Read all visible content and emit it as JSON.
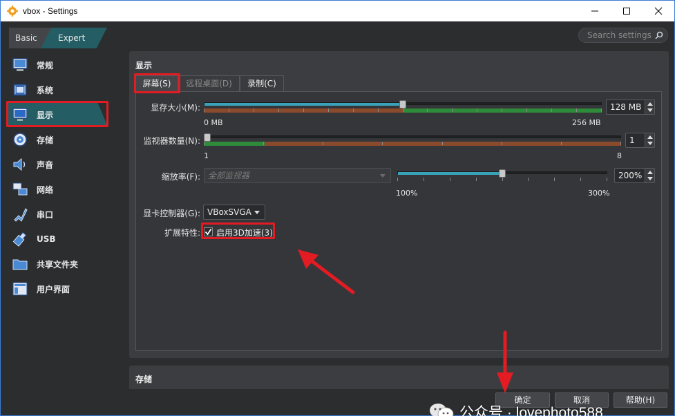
{
  "window": {
    "title": "vbox - Settings",
    "controls": [
      "minimize-icon",
      "maximize-icon",
      "close-icon"
    ]
  },
  "mode": {
    "basic_label": "Basic",
    "expert_label": "Expert",
    "active": "Expert"
  },
  "search": {
    "placeholder": "Search settings"
  },
  "sidebar": {
    "items": [
      {
        "label": "常规",
        "icon": "general-icon"
      },
      {
        "label": "系统",
        "icon": "system-chip-icon"
      },
      {
        "label": "显示",
        "icon": "display-monitor-icon",
        "active": true
      },
      {
        "label": "存储",
        "icon": "storage-disk-icon"
      },
      {
        "label": "声音",
        "icon": "audio-speaker-icon"
      },
      {
        "label": "网络",
        "icon": "network-icon"
      },
      {
        "label": "串口",
        "icon": "serial-port-icon"
      },
      {
        "label": "USB",
        "icon": "usb-icon"
      },
      {
        "label": "共享文件夹",
        "icon": "shared-folder-icon"
      },
      {
        "label": "用户界面",
        "icon": "user-interface-icon"
      }
    ]
  },
  "display": {
    "section_title": "显示",
    "tabs": [
      {
        "label": "屏幕(S)",
        "active": true,
        "enabled": true
      },
      {
        "label": "远程桌面(D)",
        "active": false,
        "enabled": false
      },
      {
        "label": "录制(C)",
        "active": false,
        "enabled": true
      }
    ],
    "video_memory": {
      "label": "显存大小(M):",
      "value": "128 MB",
      "min_label": "0 MB",
      "max_label": "256 MB",
      "fraction": 0.5
    },
    "monitor_count": {
      "label": "监视器数量(N):",
      "value": "1",
      "min_label": "1",
      "max_label": "8",
      "fraction": 0.0
    },
    "scale_factor": {
      "label": "缩放率(F):",
      "combo_placeholder": "全部监视器",
      "value": "200%",
      "min_label": "100%",
      "max_label": "300%",
      "fraction": 0.5
    },
    "graphics_controller": {
      "label": "显卡控制器(G):",
      "value": "VBoxSVGA"
    },
    "extended_features": {
      "label": "扩展特性:",
      "checkbox_label": "启用3D加速(3)",
      "checked": true
    }
  },
  "storage": {
    "section_title": "存储"
  },
  "buttons": {
    "ok": "确定",
    "cancel": "取消",
    "help": "帮助(H)"
  },
  "watermark": {
    "text": "公众号 · lovephoto588",
    "icon": "wechat-logo"
  },
  "colors": {
    "accent": "#245d64",
    "highlight": "#e31b23",
    "slider_fill": "#3aa2b8",
    "good_zone": "#2e8b3a",
    "bad_zone": "#8a4a2c"
  }
}
